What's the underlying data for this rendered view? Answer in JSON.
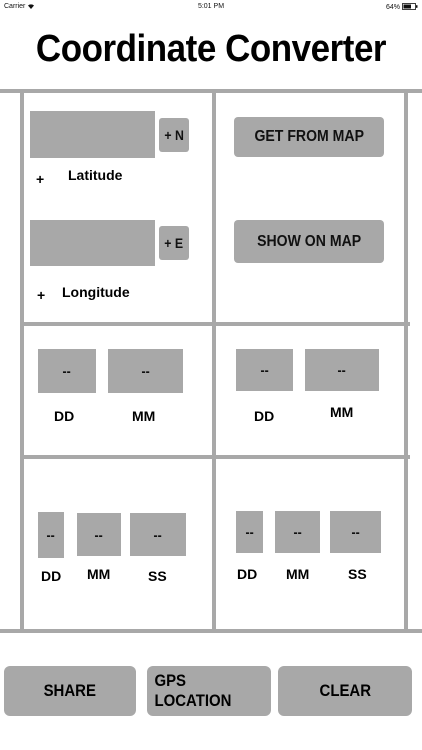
{
  "status_bar": {
    "carrier": "Carrier",
    "time": "5:01 PM",
    "battery": "64%"
  },
  "title": "Coordinate Converter",
  "input": {
    "lat_hemisphere_button": "+ N",
    "lat_sign": "+",
    "lat_label": "Latitude",
    "lon_hemisphere_button": "+ E",
    "lon_sign": "+",
    "lon_label": "Longitude",
    "lat_value": "",
    "lon_value": ""
  },
  "map_buttons": {
    "get_from_map": "GET FROM  MAP",
    "show_on_map": "SHOW ON MAP"
  },
  "dd_mm": {
    "lat": {
      "dd": "--",
      "mm": "--",
      "dd_label": "DD",
      "mm_label": "MM"
    },
    "lon": {
      "dd": "--",
      "mm": "--",
      "dd_label": "DD",
      "mm_label": "MM"
    }
  },
  "dd_mm_ss": {
    "lat": {
      "dd": "--",
      "mm": "--",
      "ss": "--",
      "dd_label": "DD",
      "mm_label": "MM",
      "ss_label": "SS"
    },
    "lon": {
      "dd": "--",
      "mm": "--",
      "ss": "--",
      "dd_label": "DD",
      "mm_label": "MM",
      "ss_label": "SS"
    }
  },
  "bottom_buttons": {
    "share": "SHARE",
    "gps_location": "GPS LOCATION",
    "clear": "CLEAR"
  },
  "colors": {
    "control_gray": "#a8a8a8",
    "background": "#ffffff"
  }
}
